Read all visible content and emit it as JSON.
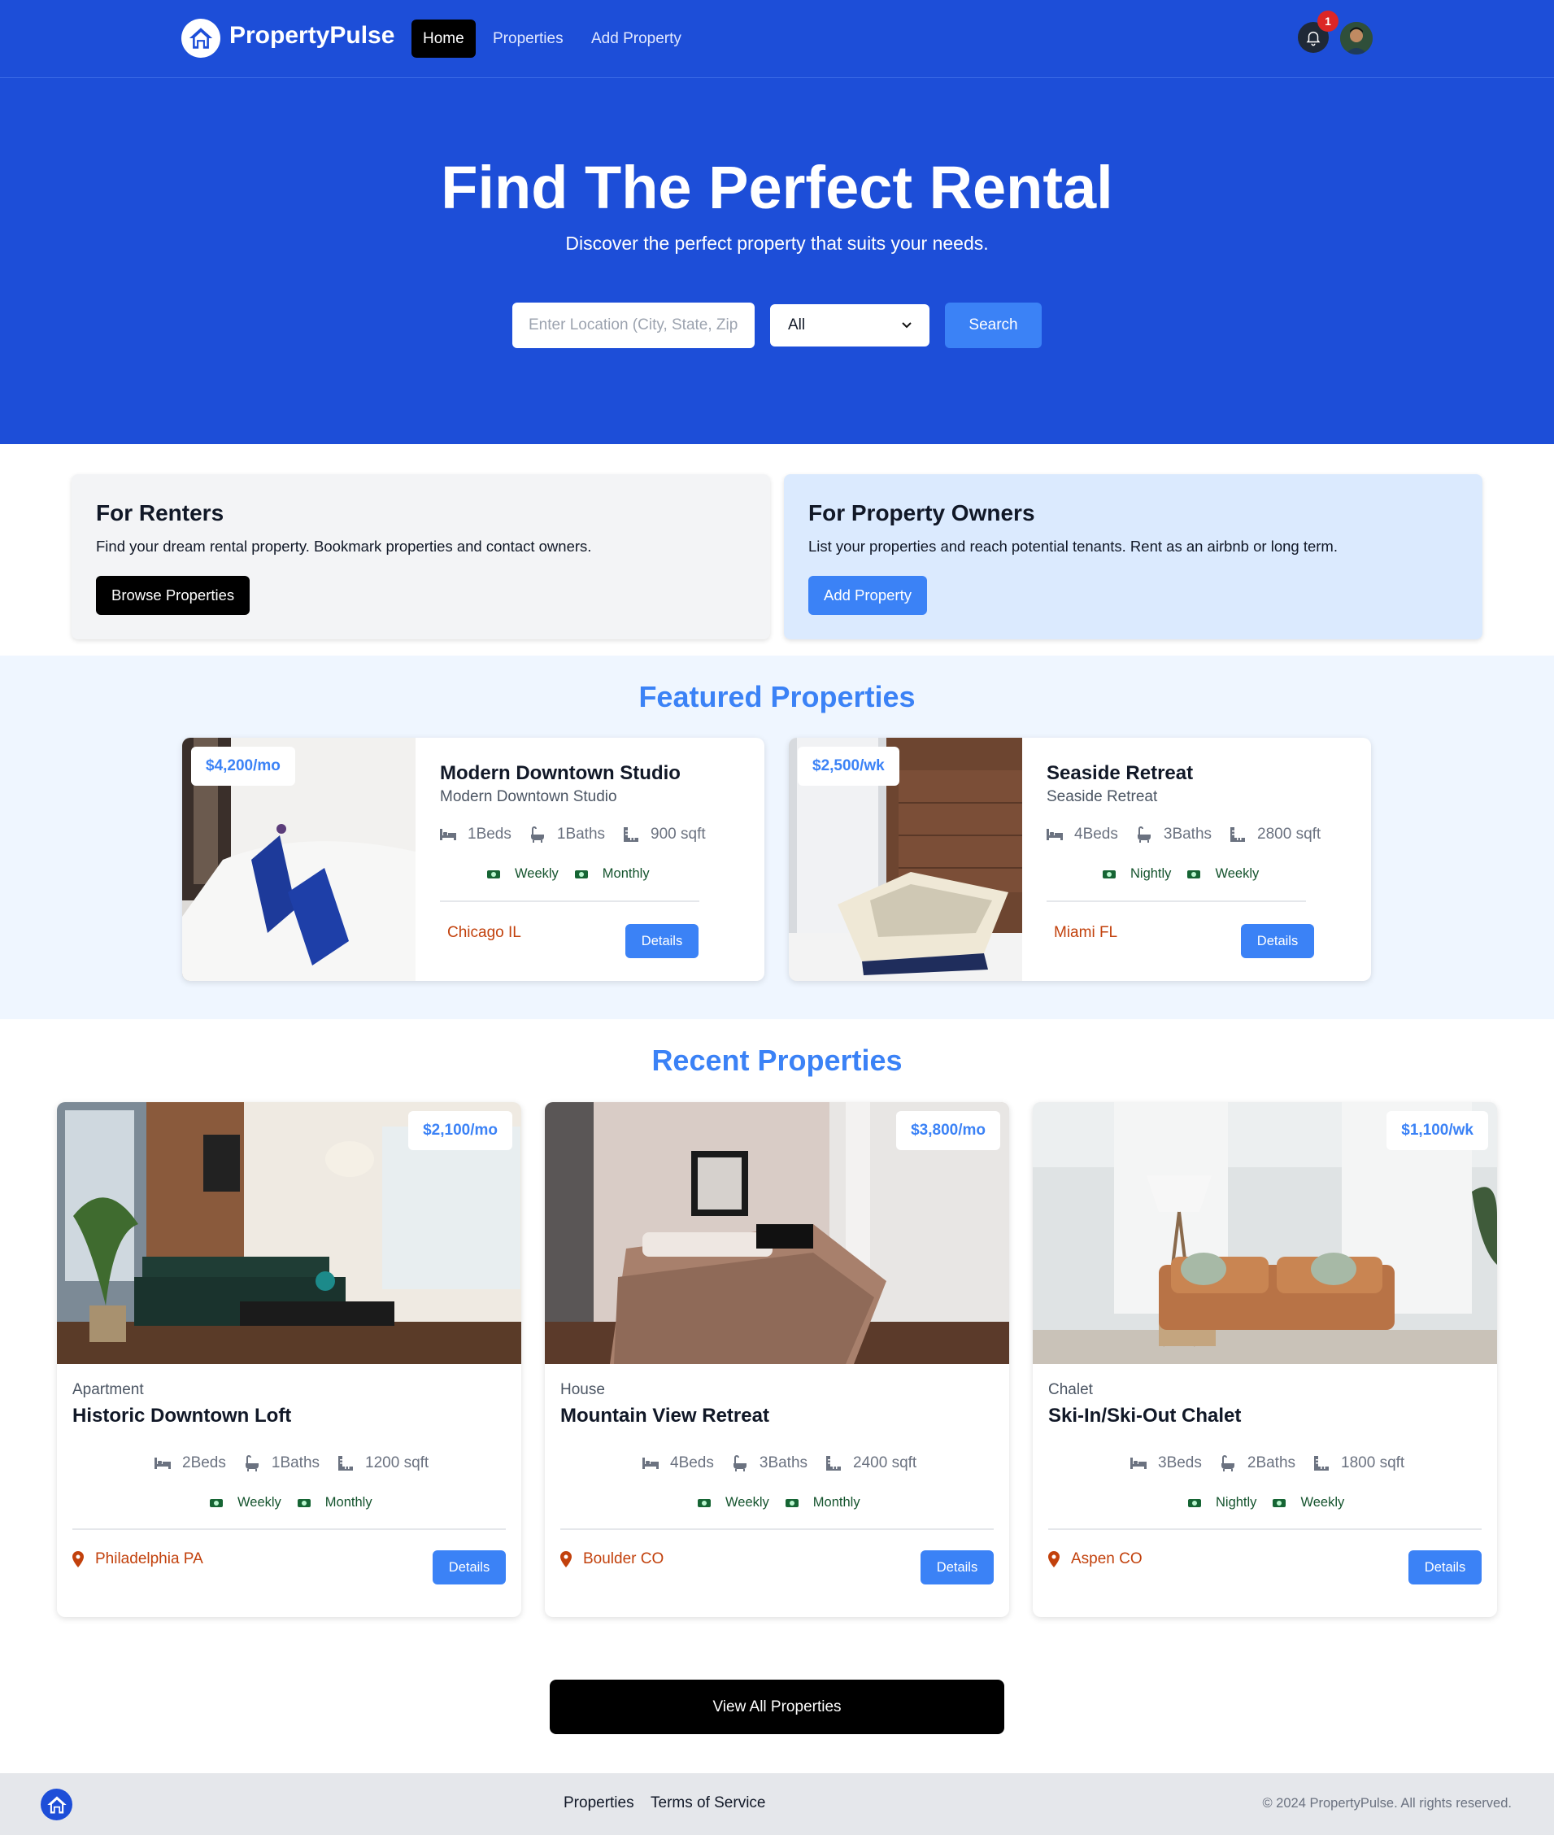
{
  "nav": {
    "brand": "PropertyPulse",
    "links": [
      "Home",
      "Properties",
      "Add Property"
    ],
    "notification_count": "1"
  },
  "hero": {
    "title": "Find The Perfect Rental",
    "subtitle": "Discover the perfect property that suits your needs.",
    "location_placeholder": "Enter Location (City, State, Zip",
    "type_selected": "All",
    "search_label": "Search"
  },
  "renters": {
    "title": "For Renters",
    "text": "Find your dream rental property. Bookmark properties and contact owners.",
    "button": "Browse Properties"
  },
  "owners": {
    "title": "For Property Owners",
    "text": "List your properties and reach potential tenants. Rent as an airbnb or long term.",
    "button": "Add Property"
  },
  "featured": {
    "title": "Featured Properties",
    "items": [
      {
        "price": "$4,200/mo",
        "name": "Modern Downtown Studio",
        "subtitle": "Modern Downtown Studio",
        "beds": "1Beds",
        "baths": "1Baths",
        "sqft": "900 sqft",
        "rates": [
          "Weekly",
          "Monthly"
        ],
        "location": "Chicago IL",
        "details": "Details"
      },
      {
        "price": "$2,500/wk",
        "name": "Seaside Retreat",
        "subtitle": "Seaside Retreat",
        "beds": "4Beds",
        "baths": "3Baths",
        "sqft": "2800 sqft",
        "rates": [
          "Nightly",
          "Weekly"
        ],
        "location": "Miami FL",
        "details": "Details"
      }
    ]
  },
  "recent": {
    "title": "Recent Properties",
    "items": [
      {
        "price": "$2,100/mo",
        "type": "Apartment",
        "name": "Historic Downtown Loft",
        "beds": "2Beds",
        "baths": "1Baths",
        "sqft": "1200 sqft",
        "rates": [
          "Weekly",
          "Monthly"
        ],
        "location": "Philadelphia PA",
        "details": "Details"
      },
      {
        "price": "$3,800/mo",
        "type": "House",
        "name": "Mountain View Retreat",
        "beds": "4Beds",
        "baths": "3Baths",
        "sqft": "2400 sqft",
        "rates": [
          "Weekly",
          "Monthly"
        ],
        "location": "Boulder CO",
        "details": "Details"
      },
      {
        "price": "$1,100/wk",
        "type": "Chalet",
        "name": "Ski-In/Ski-Out Chalet",
        "beds": "3Beds",
        "baths": "2Baths",
        "sqft": "1800 sqft",
        "rates": [
          "Nightly",
          "Weekly"
        ],
        "location": "Aspen CO",
        "details": "Details"
      }
    ],
    "view_all": "View All Properties"
  },
  "footer": {
    "links": [
      "Properties",
      "Terms of Service"
    ],
    "copyright": "© 2024 PropertyPulse. All rights reserved."
  },
  "icons": {
    "logo": "house-icon",
    "bell": "bell-icon",
    "beds": "bed-icon",
    "baths": "bath-icon",
    "sqft": "ruler-icon",
    "rate": "money-icon",
    "location": "map-marker-icon"
  },
  "colors": {
    "brand_blue": "#1d4ed8",
    "accent_blue": "#3b82f6",
    "location_orange": "#c2410c",
    "rate_green": "#14532d"
  }
}
